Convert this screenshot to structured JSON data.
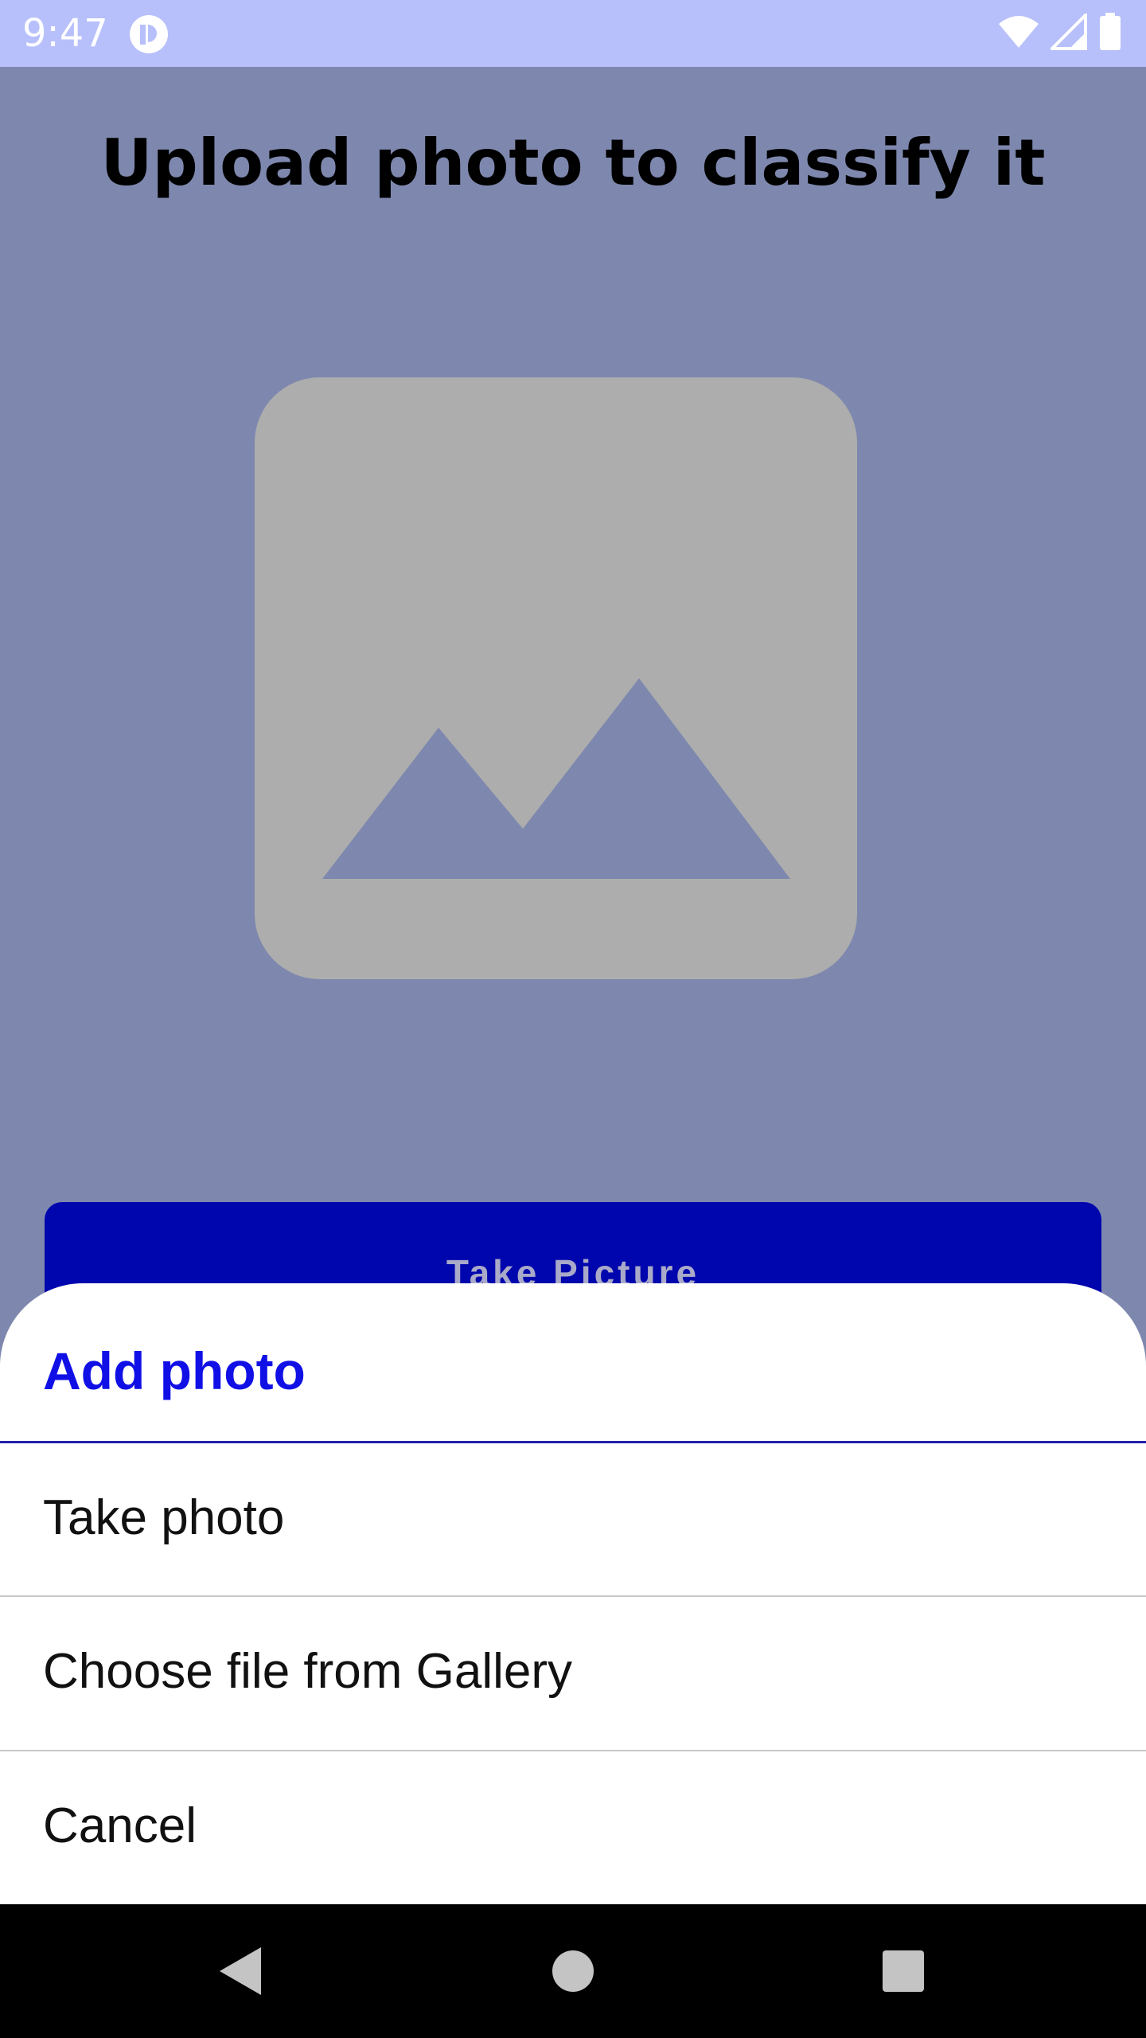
{
  "status_bar": {
    "time": "9:47",
    "icons": [
      "app-notification-icon",
      "wifi-icon",
      "cellular-signal-icon",
      "battery-icon"
    ]
  },
  "main": {
    "title": "Upload photo to classify it",
    "placeholder_icon": "image-placeholder-icon",
    "take_picture_label": "Take Picture"
  },
  "sheet": {
    "title": "Add photo",
    "options": [
      {
        "label": "Take photo"
      },
      {
        "label": "Choose file from Gallery"
      },
      {
        "label": "Cancel"
      }
    ]
  },
  "nav_bar": {
    "icons": [
      "back-icon",
      "home-icon",
      "recents-icon"
    ]
  },
  "colors": {
    "status_bar": "#b7c0fb",
    "scrim_background": "#7e88ae",
    "placeholder": "#adadad",
    "button": "#0006ad",
    "sheet_title": "#1010e6",
    "nav_bar": "#000000"
  }
}
